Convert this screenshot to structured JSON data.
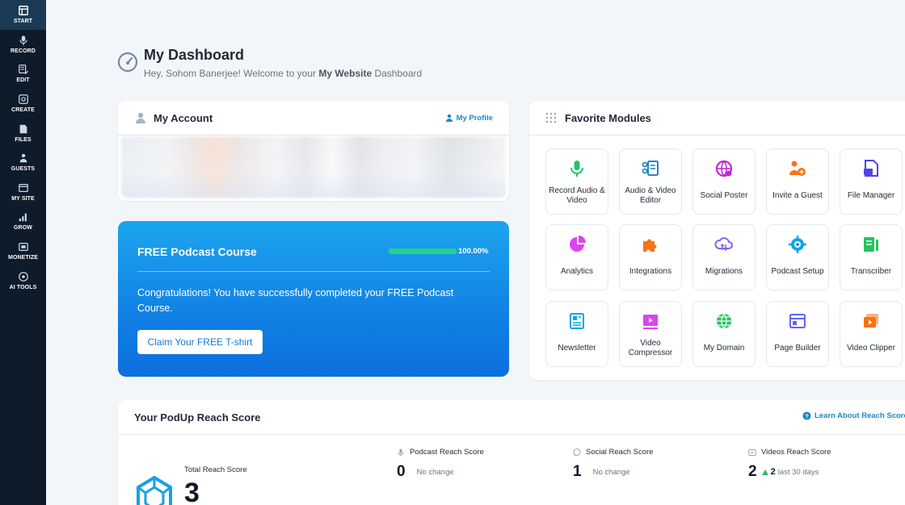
{
  "sidebar": {
    "items": [
      {
        "label": "START",
        "icon": "start-icon"
      },
      {
        "label": "RECORD",
        "icon": "microphone-icon"
      },
      {
        "label": "EDIT",
        "icon": "edit-icon"
      },
      {
        "label": "CREATE",
        "icon": "create-icon"
      },
      {
        "label": "FILES",
        "icon": "files-icon"
      },
      {
        "label": "GUESTS",
        "icon": "guests-icon"
      },
      {
        "label": "MY SITE",
        "icon": "my-site-icon"
      },
      {
        "label": "GROW",
        "icon": "grow-icon"
      },
      {
        "label": "MONETIZE",
        "icon": "monetize-icon"
      },
      {
        "label": "AI TOOLS",
        "icon": "ai-tools-icon"
      }
    ]
  },
  "header": {
    "title": "My Dashboard",
    "greeting_prefix": "Hey, Sohom Banerjee! Welcome to your ",
    "website_name": "My Website",
    "greeting_suffix": " Dashboard"
  },
  "account": {
    "title": "My Account",
    "profile_link": "My Profile"
  },
  "course": {
    "title": "FREE Podcast Course",
    "progress": 1.0,
    "progress_text": "100.00%",
    "message": "Congratulations! You have successfully completed your FREE Podcast Course.",
    "button": "Claim Your FREE T-shirt"
  },
  "modules": {
    "title": "Favorite Modules",
    "items": [
      {
        "label": "Record Audio & Video",
        "icon": "microphone-icon",
        "color": "#23c26b"
      },
      {
        "label": "Audio & Video Editor",
        "icon": "editor-icon",
        "color": "#1e88c7"
      },
      {
        "label": "Social Poster",
        "icon": "social-poster-icon",
        "color": "#c026d3"
      },
      {
        "label": "Invite a Guest",
        "icon": "invite-guest-icon",
        "color": "#f97316"
      },
      {
        "label": "File Manager",
        "icon": "file-manager-icon",
        "color": "#4f46e5"
      },
      {
        "label": "Analytics",
        "icon": "analytics-icon",
        "color": "#d946ef"
      },
      {
        "label": "Integrations",
        "icon": "integrations-icon",
        "color": "#f97316"
      },
      {
        "label": "Migrations",
        "icon": "migrations-icon",
        "color": "#8b5cf6"
      },
      {
        "label": "Podcast Setup",
        "icon": "podcast-setup-icon",
        "color": "#0ea5e9"
      },
      {
        "label": "Transcriber",
        "icon": "transcriber-icon",
        "color": "#22c55e"
      },
      {
        "label": "Newsletter",
        "icon": "newsletter-icon",
        "color": "#0ea5e9"
      },
      {
        "label": "Video Compressor",
        "icon": "video-compressor-icon",
        "color": "#d946ef"
      },
      {
        "label": "My Domain",
        "icon": "globe-icon",
        "color": "#22c55e"
      },
      {
        "label": "Page Builder",
        "icon": "page-builder-icon",
        "color": "#6366f1"
      },
      {
        "label": "Video Clipper",
        "icon": "video-clipper-icon",
        "color": "#f97316"
      }
    ]
  },
  "reach": {
    "title": "Your PodUp Reach Score",
    "learn_link": "Learn About Reach Score",
    "total_label": "Total Reach Score",
    "total_value": "3",
    "scores": [
      {
        "label": "Podcast Reach Score",
        "value": "0",
        "note": "No change",
        "icon": "microphone-icon"
      },
      {
        "label": "Social Reach Score",
        "value": "1",
        "note": "No change",
        "icon": "chat-icon"
      },
      {
        "label": "Videos Reach Score",
        "value": "2",
        "delta": "2",
        "note": "last 30 days",
        "icon": "video-icon"
      }
    ]
  },
  "colors": {
    "sidebar_bg": "#0d1b2a",
    "accent": "#1e88c7",
    "course_gradient_top": "#1ca5ee",
    "course_gradient_bottom": "#0c6fde",
    "progress_fill": "#23d38a"
  }
}
